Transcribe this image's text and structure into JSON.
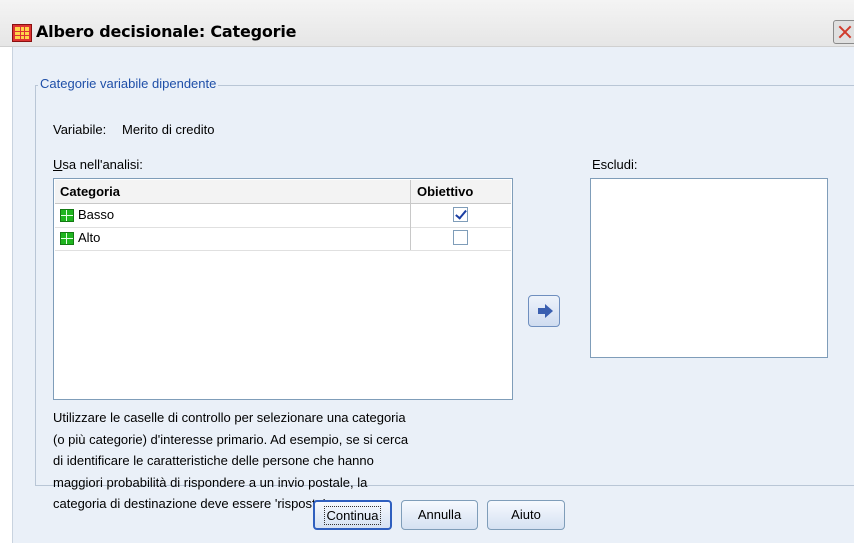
{
  "window": {
    "title": "Albero decisionale: Categorie",
    "icon": "table-icon"
  },
  "group": {
    "legend": "Categorie variabile dipendente"
  },
  "variable": {
    "label": "Variabile:",
    "value": "Merito di credito"
  },
  "use_list": {
    "label": "Usa nell'analisi:",
    "columns": [
      "Categoria",
      "Obiettivo"
    ],
    "rows": [
      {
        "name": "Basso",
        "target": true
      },
      {
        "name": "Alto",
        "target": false
      }
    ]
  },
  "exclude_list": {
    "label": "Escludi:"
  },
  "description": [
    "Utilizzare le caselle di controllo per selezionare una categoria",
    "(o più categorie) d'interesse primario. Ad esempio, se si cerca",
    "di identificare le caratteristiche delle persone che hanno",
    "maggiori probabilità di rispondere a un invio postale, la",
    "categoria di destinazione deve essere 'risposta'."
  ],
  "buttons": {
    "continue": "Continua",
    "cancel": "Annulla",
    "help": "Aiuto"
  },
  "colors": {
    "accent": "#2f5fbf",
    "legend": "#1f4fa8",
    "background": "#eaf0f8"
  }
}
